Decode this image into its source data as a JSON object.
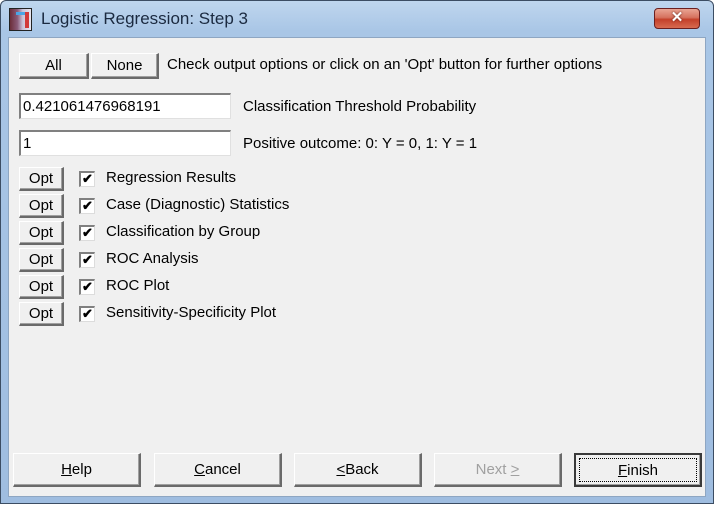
{
  "window": {
    "title": "Logistic Regression: Step 3",
    "close_glyph": "✕"
  },
  "header": {
    "all_label": "All",
    "none_label": "None",
    "instruction": "Check output options or click on an 'Opt' button for further options"
  },
  "fields": {
    "threshold": {
      "value": "0.421061476968191",
      "label": "Classification Threshold Probability"
    },
    "positive_outcome": {
      "value": "1",
      "label": "Positive outcome: 0: Y = 0, 1: Y = 1"
    }
  },
  "options": [
    {
      "opt_label": "Opt",
      "label": "Regression Results",
      "checked": true,
      "check_glyph": "✔"
    },
    {
      "opt_label": "Opt",
      "label": "Case (Diagnostic) Statistics",
      "checked": true,
      "check_glyph": "✔"
    },
    {
      "opt_label": "Opt",
      "label": "Classification by Group",
      "checked": true,
      "check_glyph": "✔"
    },
    {
      "opt_label": "Opt",
      "label": "ROC Analysis",
      "checked": true,
      "check_glyph": "✔"
    },
    {
      "opt_label": "Opt",
      "label": "ROC Plot",
      "checked": true,
      "check_glyph": "✔"
    },
    {
      "opt_label": "Opt",
      "label": "Sensitivity-Specificity Plot",
      "checked": true,
      "check_glyph": "✔"
    }
  ],
  "footer": {
    "help": {
      "mnemonic": "H",
      "rest": "elp"
    },
    "cancel": {
      "mnemonic": "C",
      "rest": "ancel"
    },
    "back": {
      "mnemonic": "<",
      "rest": " Back"
    },
    "next": {
      "pre": "Next ",
      "mnemonic": ">"
    },
    "finish": {
      "mnemonic": "F",
      "rest": "inish"
    }
  }
}
